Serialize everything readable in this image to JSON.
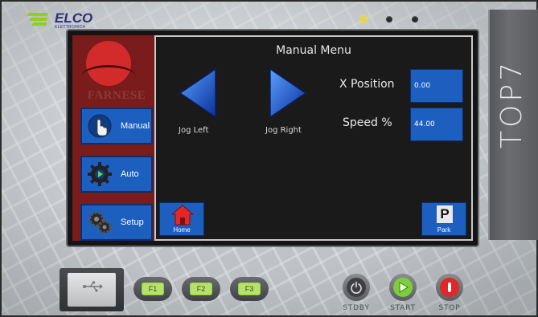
{
  "brand": {
    "name": "ELCO",
    "subtitle": "ELETTRONICA",
    "side_label": "TOP7"
  },
  "status_leds": [
    {
      "state": "on"
    },
    {
      "state": "off"
    },
    {
      "state": "off"
    }
  ],
  "screen": {
    "brand_logo_text": "FARNESE",
    "nav": [
      {
        "label": "Manual",
        "icon": "hand-pointer-icon"
      },
      {
        "label": "Auto",
        "icon": "gear-play-icon"
      },
      {
        "label": "Setup",
        "icon": "gears-icon"
      }
    ],
    "title": "Manual Menu",
    "jog_left_label": "Jog Left",
    "jog_right_label": "Jog Right",
    "x_position": {
      "label": "X Position",
      "value": "0.00"
    },
    "speed": {
      "label": "Speed %",
      "value": "44.00"
    },
    "home_label": "Home",
    "park_label": "Park",
    "park_icon_letter": "P"
  },
  "hardware": {
    "function_keys": [
      "F1",
      "F2",
      "F3"
    ],
    "controls": [
      {
        "label": "STDBY",
        "color": "#3d3f42"
      },
      {
        "label": "START",
        "color": "#7ccf3a"
      },
      {
        "label": "STOP",
        "color": "#e02828"
      }
    ]
  },
  "colors": {
    "accent_blue": "#1d5fbf",
    "screen_bg": "#1a1a1a",
    "brand_red": "#d32b2b",
    "led_yellow": "#e9d63a"
  }
}
